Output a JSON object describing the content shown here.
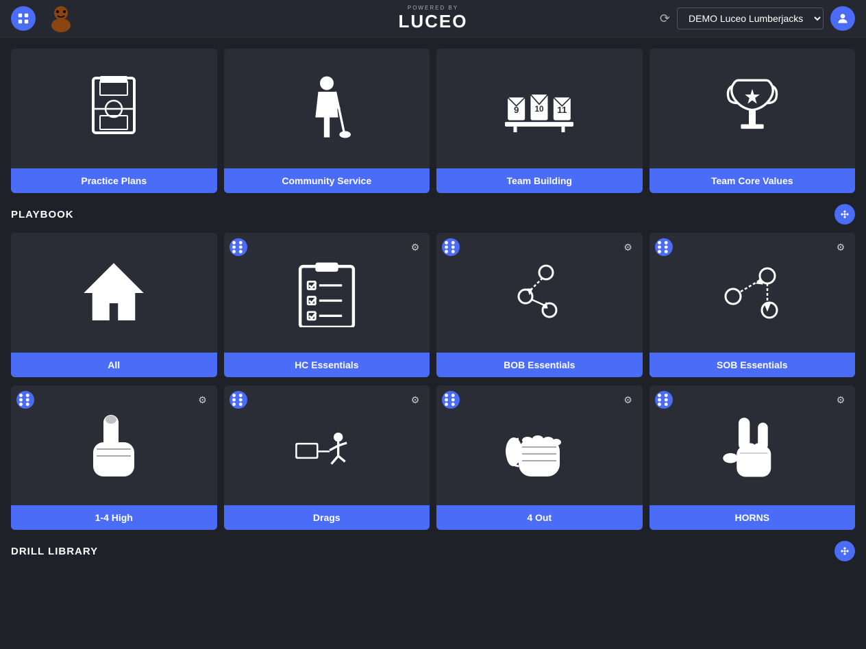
{
  "header": {
    "grid_label": "grid",
    "powered_by": "POWERED BY",
    "brand": "LUCEO",
    "team_name": "DEMO Luceo Lumberjacks",
    "avatar_icon": "👤"
  },
  "top_cards": [
    {
      "id": "practice-plans",
      "label": "Practice Plans",
      "icon": "basketball-court"
    },
    {
      "id": "community-service",
      "label": "Community Service",
      "icon": "janitor"
    },
    {
      "id": "team-building",
      "label": "Team Building",
      "icon": "team"
    },
    {
      "id": "team-core-values",
      "label": "Team Core Values",
      "icon": "trophy"
    }
  ],
  "playbook": {
    "section_title": "PLAYBOOK",
    "cards": [
      {
        "id": "all",
        "label": "All",
        "icon": "home",
        "has_overlay": false
      },
      {
        "id": "hc-essentials",
        "label": "HC Essentials",
        "icon": "clipboard",
        "has_overlay": true
      },
      {
        "id": "bob-essentials",
        "label": "BOB Essentials",
        "icon": "play-diagram",
        "has_overlay": true
      },
      {
        "id": "sob-essentials",
        "label": "SOB Essentials",
        "icon": "play-diagram2",
        "has_overlay": true
      },
      {
        "id": "1-4-high",
        "label": "1-4 High",
        "icon": "finger-point",
        "has_overlay": true
      },
      {
        "id": "drags",
        "label": "Drags",
        "icon": "drag-play",
        "has_overlay": true
      },
      {
        "id": "4-out",
        "label": "4 Out",
        "icon": "hand-signal",
        "has_overlay": true
      },
      {
        "id": "horns",
        "label": "HORNS",
        "icon": "horns-sign",
        "has_overlay": true
      }
    ]
  },
  "drill_library": {
    "section_title": "DRILL LIBRARY"
  }
}
